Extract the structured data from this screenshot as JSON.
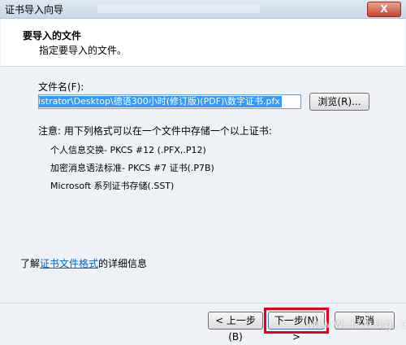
{
  "window": {
    "title": "证书导入向导",
    "close_label": "X"
  },
  "header": {
    "title": "要导入的文件",
    "subtitle": "指定要导入的文件。"
  },
  "file": {
    "label": "文件名(F):",
    "value": "istrator\\Desktop\\德语300小时(修订版)(PDF)\\数字证书.pfx",
    "browse_label": "浏览(R)..."
  },
  "note": {
    "intro": "注意: 用下列格式可以在一个文件中存储一个以上证书:",
    "formats": [
      "个人信息交换- PKCS #12 (.PFX,.P12)",
      "加密消息语法标准- PKCS #7 证书(.P7B)",
      "Microsoft 系列证书存储(.SST)"
    ]
  },
  "more_info": {
    "prefix": "了解",
    "link": "证书文件格式",
    "suffix": "的详细信息"
  },
  "buttons": {
    "back": "< 上一步(B)",
    "next": "下一步(N) >",
    "cancel": "取消"
  },
  "watermark": "www.itbug.c"
}
